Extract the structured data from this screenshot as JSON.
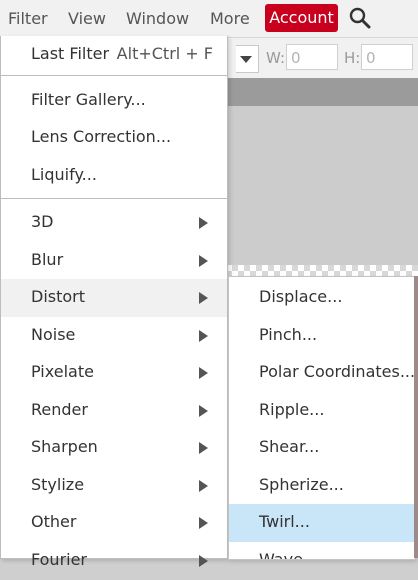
{
  "menubar": {
    "items": [
      "Filter",
      "View",
      "Window",
      "More"
    ],
    "account_label": "Account",
    "search_icon": "search-icon"
  },
  "options_bar": {
    "w_label": "W:",
    "w_value": "0",
    "h_label": "H:",
    "h_value": "0"
  },
  "filter_menu": {
    "last_filter": {
      "label": "Last Filter",
      "shortcut": "Alt+Ctrl + F"
    },
    "group1": [
      "Filter Gallery...",
      "Lens Correction...",
      "Liquify..."
    ],
    "categories": [
      "3D",
      "Blur",
      "Distort",
      "Noise",
      "Pixelate",
      "Render",
      "Sharpen",
      "Stylize",
      "Other",
      "Fourier"
    ],
    "active_category": "Distort"
  },
  "distort_submenu": {
    "items": [
      "Displace...",
      "Pinch...",
      "Polar Coordinates...",
      "Ripple...",
      "Shear...",
      "Spherize...",
      "Twirl...",
      "Wave..."
    ],
    "highlighted": "Twirl..."
  },
  "colors": {
    "account_bg": "#c8001e",
    "highlight": "#c8e6f8",
    "menubar_bg": "#f1f1f1"
  }
}
